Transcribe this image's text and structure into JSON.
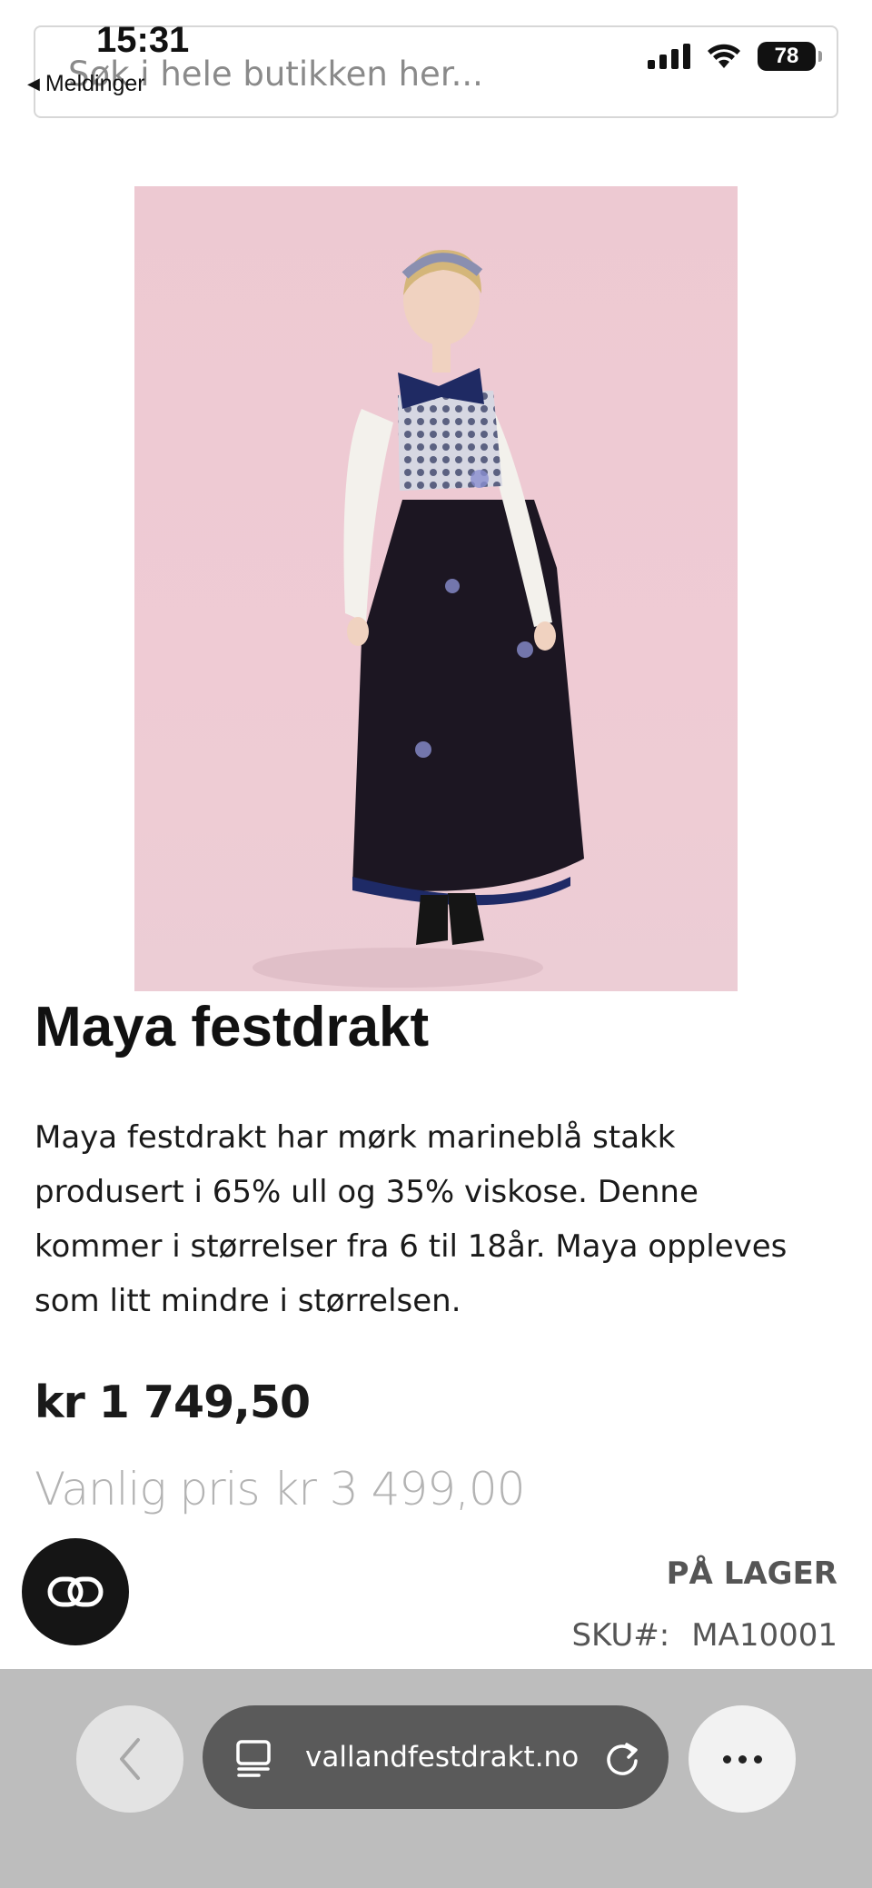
{
  "status_bar": {
    "time": "15:31",
    "back_label": "Meldinger",
    "battery": "78"
  },
  "search": {
    "placeholder": "Søk i hele butikken her..."
  },
  "product": {
    "title": "Maya festdrakt",
    "description": "Maya festdrakt har mørk marineblå stakk produsert i 65% ull og 35% viskose. Denne kommer i størrelser fra 6 til 18år. Maya oppleves som litt mindre i størrelsen.",
    "price": "kr 1 749,50",
    "regular_price": "Vanlig pris kr 3 499,00",
    "stock": "PÅ LAGER",
    "sku_label": "SKU#:",
    "sku_value": "MA10001"
  },
  "browser": {
    "url": "vallandfestdrakt.no"
  },
  "icons": {
    "back": "chevron-left-icon",
    "reader": "reader-mode-icon",
    "reload": "reload-icon",
    "more": "more-dots-icon",
    "chat": "chat-link-icon"
  },
  "colors": {
    "image_background": "#edc9d2",
    "browser_bar": "#bdbdbd",
    "url_pill": "#5a5a5a",
    "chat_button": "#151515",
    "regular_price": "#b3b3b3"
  }
}
